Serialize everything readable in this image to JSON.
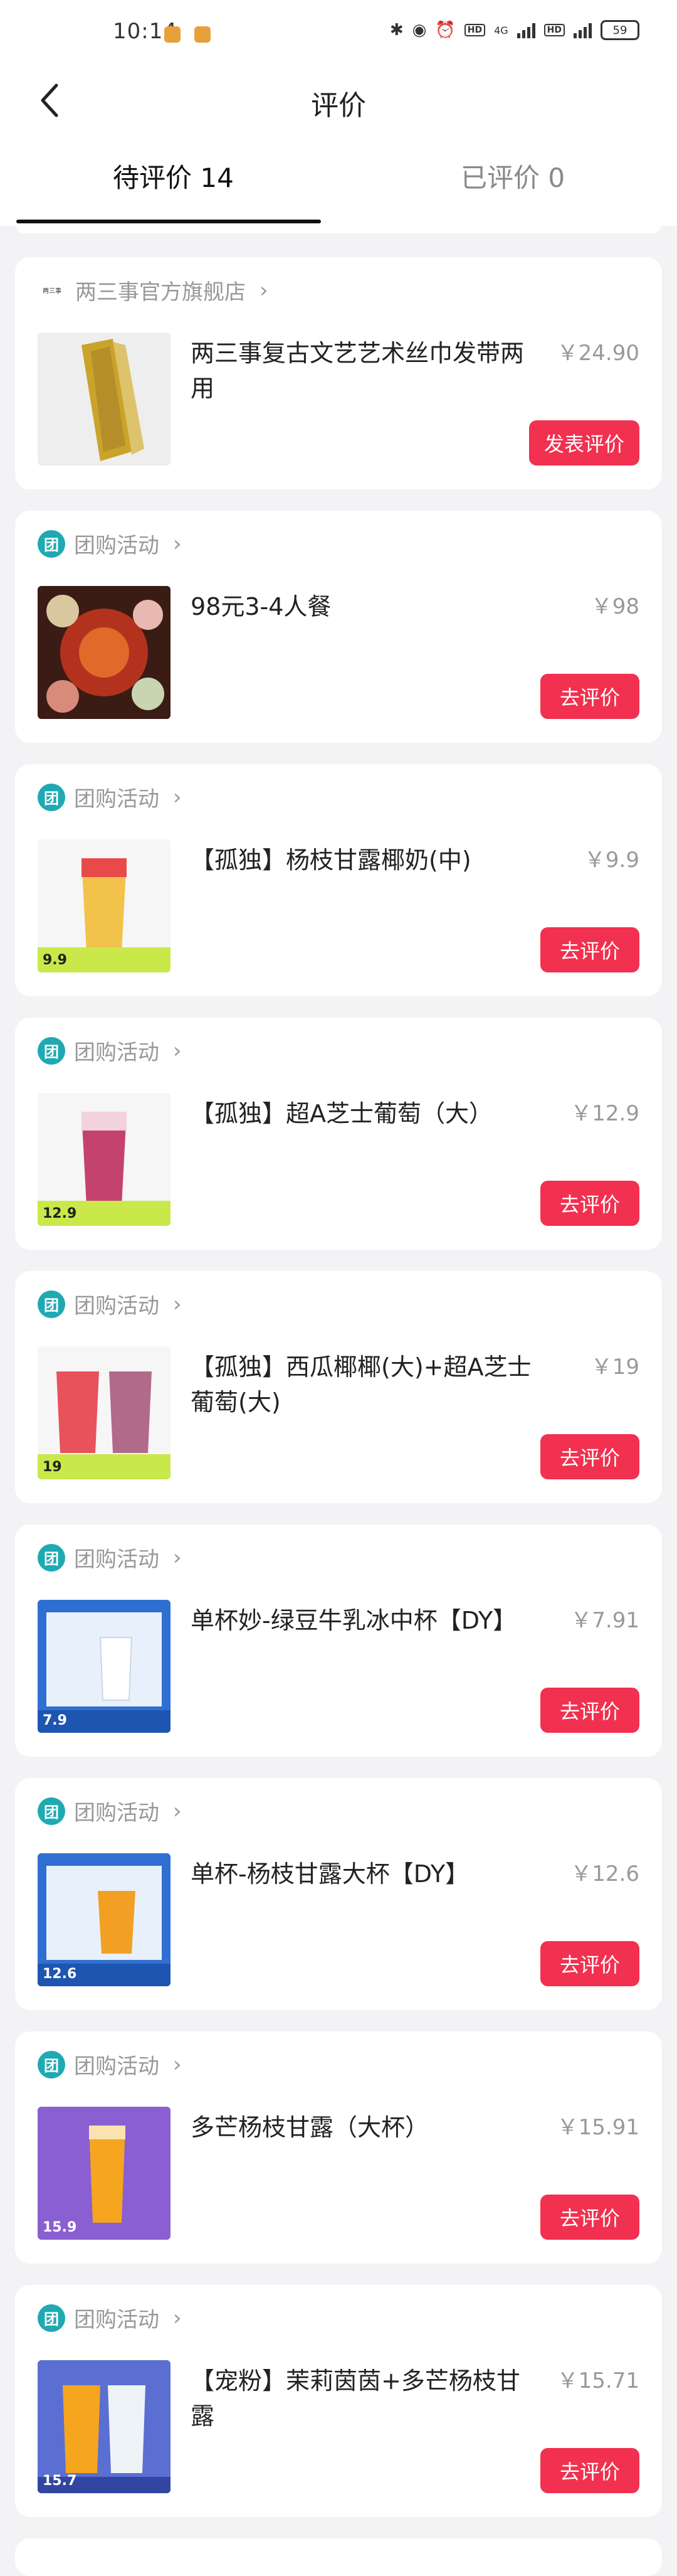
{
  "status_bar": {
    "time": "10:14",
    "network": "4G",
    "battery": "59"
  },
  "header": {
    "title": "评价"
  },
  "tabs": [
    {
      "label": "待评价 14",
      "active": true
    },
    {
      "label": "已评价 0",
      "active": false
    }
  ],
  "cards": [
    {
      "source": "两三事官方旗舰店",
      "source_type": "shop",
      "shop_logo_text": "两三事",
      "name": "两三事复古文艺艺术丝巾发带两用",
      "price": "￥24.90",
      "button": "发表评价",
      "thumb_badge": ""
    },
    {
      "source": "团购活动",
      "source_type": "group",
      "name": "98元3-4人餐",
      "price": "￥98",
      "button": "去评价",
      "thumb_badge": ""
    },
    {
      "source": "团购活动",
      "source_type": "group",
      "name": "【孤独】杨枝甘露椰奶(中)",
      "price": "￥9.9",
      "button": "去评价",
      "thumb_badge": "9.9"
    },
    {
      "source": "团购活动",
      "source_type": "group",
      "name": "【孤独】超A芝士葡萄（大）",
      "price": "￥12.9",
      "button": "去评价",
      "thumb_badge": "12.9"
    },
    {
      "source": "团购活动",
      "source_type": "group",
      "name": "【孤独】西瓜椰椰(大)+超A芝士葡萄(大)",
      "price": "￥19",
      "button": "去评价",
      "thumb_badge": "19"
    },
    {
      "source": "团购活动",
      "source_type": "group",
      "name": "单杯妙-绿豆牛乳冰中杯【DY】",
      "price": "￥7.91",
      "button": "去评价",
      "thumb_badge": "7.9"
    },
    {
      "source": "团购活动",
      "source_type": "group",
      "name": "单杯-杨枝甘露大杯【DY】",
      "price": "￥12.6",
      "button": "去评价",
      "thumb_badge": "12.6"
    },
    {
      "source": "团购活动",
      "source_type": "group",
      "name": "多芒杨枝甘露（大杯）",
      "price": "￥15.91",
      "button": "去评价",
      "thumb_badge": "15.9"
    },
    {
      "source": "团购活动",
      "source_type": "group",
      "name": "【宠粉】茉莉茵茵+多芒杨枝甘露",
      "price": "￥15.71",
      "button": "去评价",
      "thumb_badge": "15.7"
    }
  ],
  "group_icon_label": "团",
  "colors": {
    "accent_button": "#f2304f",
    "group_icon": "#1fa9b3",
    "background": "#f3f3f5"
  }
}
